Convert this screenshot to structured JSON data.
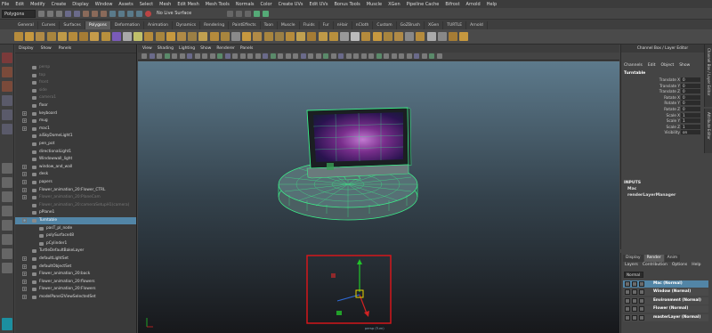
{
  "menubar": [
    "File",
    "Edit",
    "Modify",
    "Create",
    "Display",
    "Window",
    "Assets",
    "Select",
    "Mesh",
    "Edit Mesh",
    "Mesh Tools",
    "Normals",
    "Color",
    "Create UVs",
    "Edit UVs",
    "Bonus Tools",
    "Muscle",
    "XGen",
    "Pipeline Cache",
    "Bifrost",
    "Arnold",
    "Help"
  ],
  "status_line": {
    "mode": "Polygons",
    "live_surface": "No Live Surface"
  },
  "shelf_tabs": [
    "General",
    "Curves",
    "Surfaces",
    "Polygons",
    "Deformation",
    "Animation",
    "Dynamics",
    "Rendering",
    "PaintEffects",
    "Toon",
    "Muscle",
    "Fluids",
    "Fur",
    "nHair",
    "nCloth",
    "Custom",
    "GoZBrush",
    "XGen",
    "TURTLE",
    "Arnold"
  ],
  "shelf_active": "Polygons",
  "outliner": {
    "menu": [
      "Display",
      "Show",
      "Panels"
    ],
    "rows": [
      {
        "label": "persp",
        "dim": true,
        "expand": false,
        "indent": 0
      },
      {
        "label": "top",
        "dim": true,
        "expand": false,
        "indent": 0
      },
      {
        "label": "front",
        "dim": true,
        "expand": false,
        "indent": 0
      },
      {
        "label": "side",
        "dim": true,
        "expand": false,
        "indent": 0
      },
      {
        "label": "camera1",
        "dim": true,
        "expand": false,
        "indent": 0
      },
      {
        "label": "floor",
        "dim": false,
        "expand": false,
        "indent": 0
      },
      {
        "label": "keyboard",
        "dim": false,
        "expand": true,
        "indent": 0
      },
      {
        "label": "mug",
        "dim": false,
        "expand": true,
        "indent": 0
      },
      {
        "label": "mac1",
        "dim": false,
        "expand": true,
        "indent": 0
      },
      {
        "label": "aiSkyDomeLight1",
        "dim": false,
        "expand": false,
        "indent": 0
      },
      {
        "label": "pen_pot",
        "dim": false,
        "expand": false,
        "indent": 0
      },
      {
        "label": "directionalLight1",
        "dim": false,
        "expand": false,
        "indent": 0
      },
      {
        "label": "Windowwall_light",
        "dim": false,
        "expand": false,
        "indent": 0
      },
      {
        "label": "window_and_wall",
        "dim": false,
        "expand": true,
        "indent": 0
      },
      {
        "label": "desk",
        "dim": false,
        "expand": true,
        "indent": 0
      },
      {
        "label": "papers",
        "dim": false,
        "expand": true,
        "indent": 0
      },
      {
        "label": "Flower_animation_20:Flower_CTRL",
        "dim": false,
        "expand": true,
        "indent": 0
      },
      {
        "label": "Flower_animation_20:PlaneCam",
        "dim": true,
        "expand": true,
        "indent": 0
      },
      {
        "label": "Flower_animation_20:cameraSetupH1(camera)",
        "dim": true,
        "expand": false,
        "indent": 0
      },
      {
        "label": "pPlane1",
        "dim": false,
        "expand": false,
        "indent": 0
      },
      {
        "label": "Turntable",
        "dim": false,
        "expand": true,
        "indent": 0,
        "selected": true
      },
      {
        "label": "pasT_pl_node",
        "dim": false,
        "expand": false,
        "indent": 1
      },
      {
        "label": "polySurface48",
        "dim": false,
        "expand": false,
        "indent": 1
      },
      {
        "label": "pCylinder1",
        "dim": false,
        "expand": false,
        "indent": 1
      },
      {
        "label": "TurtleDefaultBakeLayer",
        "dim": false,
        "expand": false,
        "indent": 0
      },
      {
        "label": "defaultLightSet",
        "dim": false,
        "expand": true,
        "indent": 0
      },
      {
        "label": "defaultObjectSet",
        "dim": false,
        "expand": true,
        "indent": 0
      },
      {
        "label": "Flower_animation_20:back",
        "dim": false,
        "expand": true,
        "indent": 0
      },
      {
        "label": "Flower_animation_20:flowers",
        "dim": false,
        "expand": true,
        "indent": 0
      },
      {
        "label": "Flower_animation_20:Flowers",
        "dim": false,
        "expand": true,
        "indent": 0
      },
      {
        "label": "modelPanel2ViewSelectedSet",
        "dim": false,
        "expand": true,
        "indent": 0
      }
    ]
  },
  "viewport_menu": [
    "View",
    "Shading",
    "Lighting",
    "Show",
    "Renderer",
    "Panels"
  ],
  "viewport_status": "persp (Turn)",
  "channel_box": {
    "header": "Channel Box / Layer Editor",
    "menu": [
      "Channels",
      "Edit",
      "Object",
      "Show"
    ],
    "object": "Turntable",
    "attrs": [
      {
        "label": "Translate X",
        "value": "0"
      },
      {
        "label": "Translate Y",
        "value": "0"
      },
      {
        "label": "Translate Z",
        "value": "0"
      },
      {
        "label": "Rotate X",
        "value": "0"
      },
      {
        "label": "Rotate Y",
        "value": "0"
      },
      {
        "label": "Rotate Z",
        "value": "0"
      },
      {
        "label": "Scale X",
        "value": "1"
      },
      {
        "label": "Scale Y",
        "value": "1"
      },
      {
        "label": "Scale Z",
        "value": "1"
      },
      {
        "label": "Visibility",
        "value": "on"
      }
    ],
    "inputs_title": "INPUTS",
    "inputs": [
      "Mac",
      "renderLayerManager"
    ],
    "side_tabs": [
      "Channel Box / Layer Editor",
      "Attribute Editor"
    ]
  },
  "layer_editor": {
    "tabs": [
      "Display",
      "Render",
      "Anim"
    ],
    "active_tab": "Render",
    "menu": [
      "Layers",
      "Contribution",
      "Options",
      "Help"
    ],
    "mode": "Normal",
    "layers": [
      {
        "name": "Mac (Normal)",
        "selected": true
      },
      {
        "name": "Window (Normal)",
        "selected": false
      },
      {
        "name": "Environment (Normal)",
        "selected": false
      },
      {
        "name": "Flower (Normal)",
        "selected": false
      },
      {
        "name": "masterLayer (Normal)",
        "selected": false
      }
    ]
  },
  "colors": {
    "selection": "#5285a6",
    "wireframe": "#3cf08a",
    "highlight_box": "#e0161a",
    "gizmo_y": "#22c42a",
    "gizmo_x": "#d22222",
    "gizmo_z": "#2f6bd8",
    "gizmo_center": "#e8d400"
  }
}
